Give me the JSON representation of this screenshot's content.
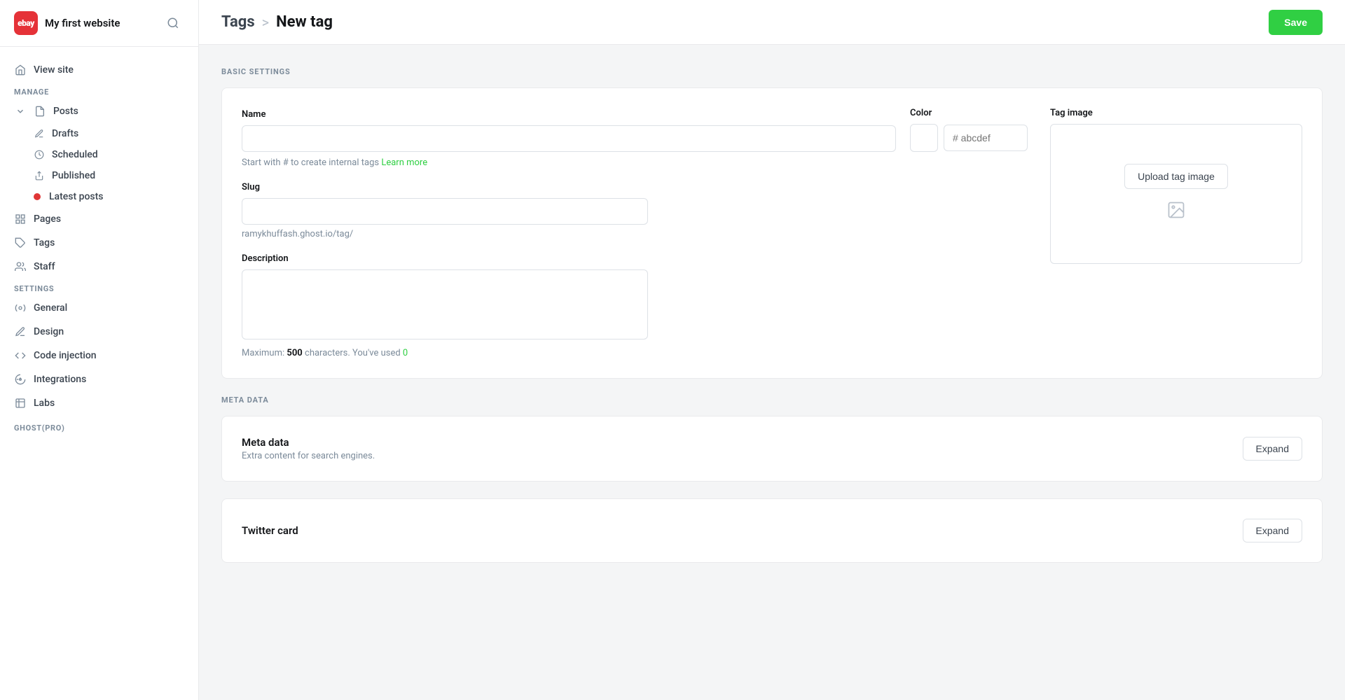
{
  "brand": {
    "logo_text": "ebay",
    "site_name": "My first website"
  },
  "sidebar": {
    "view_site_label": "View site",
    "manage_label": "MANAGE",
    "posts_label": "Posts",
    "drafts_label": "Drafts",
    "scheduled_label": "Scheduled",
    "published_label": "Published",
    "latest_posts_label": "Latest posts",
    "pages_label": "Pages",
    "tags_label": "Tags",
    "staff_label": "Staff",
    "settings_label": "SETTINGS",
    "general_label": "General",
    "design_label": "Design",
    "code_injection_label": "Code injection",
    "integrations_label": "Integrations",
    "labs_label": "Labs",
    "ghost_pro_label": "GHOST(PRO)"
  },
  "topbar": {
    "breadcrumb_tags": "Tags",
    "breadcrumb_sep": ">",
    "breadcrumb_current": "New tag",
    "save_label": "Save"
  },
  "basic_settings": {
    "section_label": "BASIC SETTINGS",
    "name_label": "Name",
    "name_placeholder": "",
    "color_label": "Color",
    "color_placeholder": "# abcdef",
    "hint_text": "Start with # to create internal tags",
    "learn_more_label": "Learn more",
    "tag_image_label": "Tag image",
    "upload_label": "Upload tag image",
    "slug_label": "Slug",
    "slug_placeholder": "",
    "slug_hint": "ramykhuffash.ghost.io/tag/",
    "description_label": "Description",
    "description_placeholder": "",
    "max_chars_text": "Maximum:",
    "max_chars_count": "500",
    "used_text": "characters. You've used",
    "used_count": "0"
  },
  "meta_data": {
    "section_label": "META DATA",
    "meta_title": "Meta data",
    "meta_sub": "Extra content for search engines.",
    "expand_label": "Expand"
  },
  "twitter_card": {
    "title": "Twitter card",
    "expand_label": "Expand"
  }
}
